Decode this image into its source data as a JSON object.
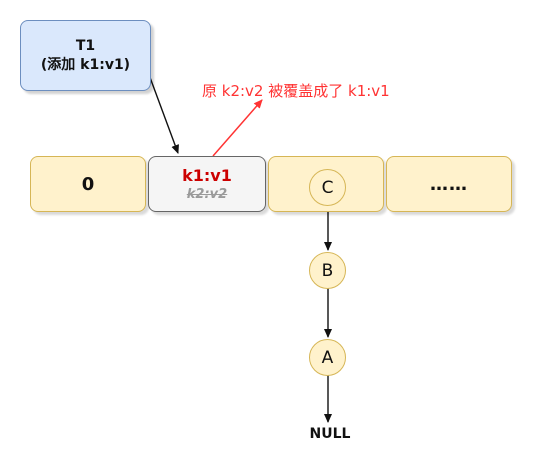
{
  "thread_box": {
    "title": "T1",
    "action": "(添加 k1:v1)"
  },
  "annotation": "原 k2:v2 被覆盖成了 k1:v1",
  "table_slots": [
    {
      "label": "0"
    },
    {
      "new_entry": "k1:v1",
      "old_entry": "k2:v2"
    },
    {
      "node": "C"
    },
    {
      "label": "……"
    }
  ],
  "chain": [
    "C",
    "B",
    "A"
  ],
  "chain_end": "NULL",
  "colors": {
    "thread_fill": "#dae8fc",
    "thread_border": "#6c8ebf",
    "slot_fill": "#fff2cc",
    "slot_border": "#d6b656",
    "updated_slot_fill": "#f5f5f5",
    "highlight_red": "#cc0000",
    "annotation_red": "#ff3333"
  }
}
